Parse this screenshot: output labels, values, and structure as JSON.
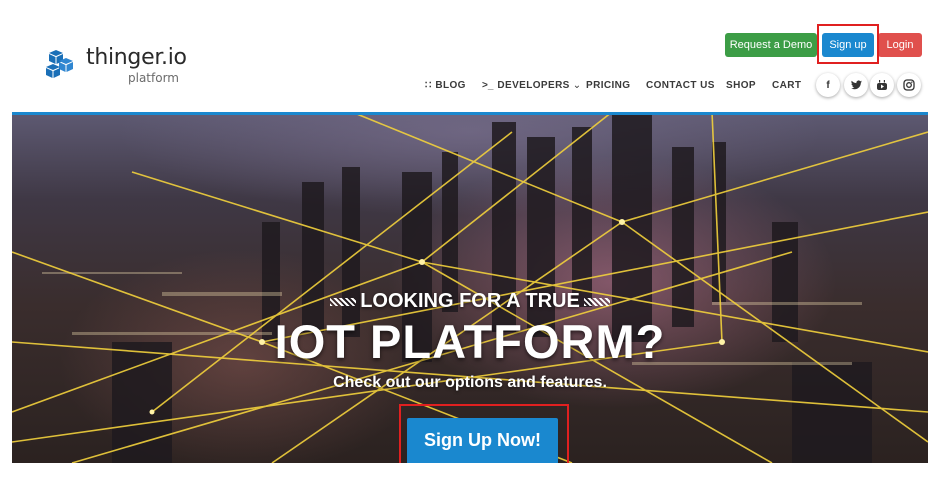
{
  "logo": {
    "name": "thinger.io",
    "subtitle": "platform",
    "icon": "blue-cubes-logo-icon"
  },
  "top_buttons": {
    "request_demo": "Request a Demo",
    "sign_up": "Sign up",
    "login": "Login"
  },
  "nav": {
    "items": [
      {
        "label": "BLOG",
        "icon": "rss-icon"
      },
      {
        "label": "DEVELOPERS",
        "icon": "terminal-icon",
        "dropdown": true
      },
      {
        "label": "PRICING"
      },
      {
        "label": "CONTACT US"
      },
      {
        "label": "SHOP"
      },
      {
        "label": "CART"
      }
    ],
    "icon_glyphs": {
      "rss": "∷",
      "terminal": ">_",
      "chevron": "⌄"
    }
  },
  "social": [
    {
      "name": "facebook-icon",
      "glyph": "f"
    },
    {
      "name": "twitter-icon",
      "glyph": "🐦"
    },
    {
      "name": "youtube-icon",
      "glyph": "▶"
    },
    {
      "name": "instagram-icon",
      "glyph": "◎"
    }
  ],
  "hero": {
    "kicker": "LOOKING FOR A TRUE",
    "title": "IOT PLATFORM?",
    "subtitle": "Check out our options and features.",
    "cta": "Sign Up Now!"
  },
  "colors": {
    "primary_blue": "#1a88cf",
    "demo_green": "#3c9d46",
    "login_red": "#e0504d",
    "highlight_red": "#e02020",
    "network_yellow": "#f2d13c"
  }
}
